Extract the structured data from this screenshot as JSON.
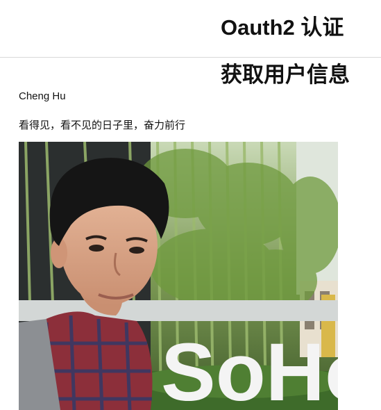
{
  "header": {
    "title": "Oauth2 认证"
  },
  "section": {
    "title": "获取用户信息"
  },
  "user": {
    "name": "Cheng Hu",
    "bio": "看得见，看不见的日子里，奋力前行",
    "avatar": {
      "sign_text": "SoHo"
    }
  }
}
